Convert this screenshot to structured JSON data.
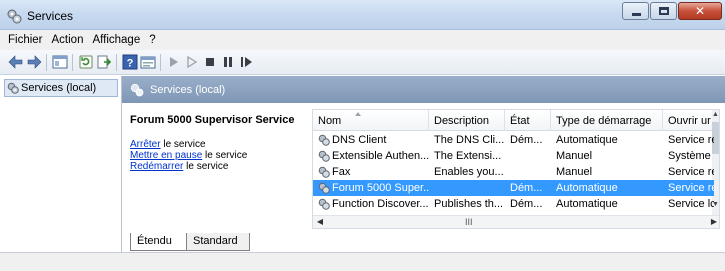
{
  "window": {
    "title": "Services"
  },
  "menu": [
    "Fichier",
    "Action",
    "Affichage",
    "?"
  ],
  "toolbar": {
    "icons": [
      "back-arrow-icon",
      "forward-arrow-icon",
      "show-hide-tree-icon",
      "refresh-icon",
      "export-list-icon",
      "help-icon",
      "properties-icon",
      "start-service-icon",
      "start-service-alt-icon",
      "stop-service-icon",
      "pause-service-icon",
      "restart-service-icon"
    ]
  },
  "tree": {
    "root_label": "Services (local)"
  },
  "header_band": {
    "title": "Services (local)"
  },
  "detail": {
    "service_name": "Forum 5000 Supervisor Service",
    "action1_link": "Arrêter",
    "action1_rest": " le service",
    "action2_link": "Mettre en pause",
    "action2_rest": " le service",
    "action3_link": "Redémarrer",
    "action3_rest": " le service"
  },
  "list": {
    "columns": [
      "Nom",
      "Description",
      "État",
      "Type de démarrage",
      "Ouvrir ur"
    ],
    "rows": [
      {
        "name": "DNS Client",
        "desc": "The DNS Cli...",
        "state": "Dém...",
        "startup": "Automatique",
        "logon": "Service re",
        "selected": false
      },
      {
        "name": "Extensible Authen...",
        "desc": "The Extensi...",
        "state": "",
        "startup": "Manuel",
        "logon": "Système",
        "selected": false
      },
      {
        "name": "Fax",
        "desc": "Enables you...",
        "state": "",
        "startup": "Manuel",
        "logon": "Service re",
        "selected": false
      },
      {
        "name": "Forum 5000 Super...",
        "desc": "",
        "state": "Dém...",
        "startup": "Automatique",
        "logon": "Service re",
        "selected": true
      },
      {
        "name": "Function Discover...",
        "desc": "Publishes th...",
        "state": "Dém...",
        "startup": "Automatique",
        "logon": "Service lc",
        "selected": false
      }
    ],
    "hscroll_grip": "III"
  },
  "tabs": {
    "extended": "Étendu",
    "standard": "Standard"
  },
  "colors": {
    "selection": "#3399ff",
    "header_band": "#8aa2c0",
    "link": "#0033cc"
  }
}
